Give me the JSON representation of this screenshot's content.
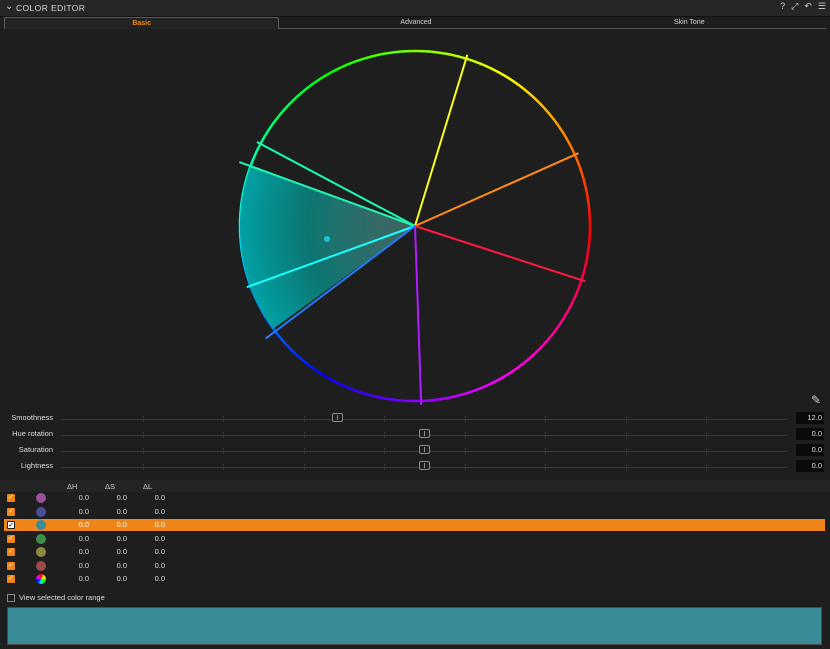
{
  "window": {
    "title": "COLOR EDITOR",
    "colors": {
      "accent": "#f08a1e",
      "preview": "#3a8c98"
    }
  },
  "toolbar_icons": [
    "help-icon",
    "expand-icon",
    "reset-icon",
    "menu-icon"
  ],
  "toolbar_glyphs": [
    "?",
    "⤢",
    "↶",
    "☰"
  ],
  "tabs": [
    {
      "label": "Basic",
      "active": true
    },
    {
      "label": "Advanced",
      "active": false
    },
    {
      "label": "Skin Tone",
      "active": false
    }
  ],
  "sliders": [
    {
      "label": "Smoothness",
      "value": "12.0",
      "level": 0.38
    },
    {
      "label": "Hue rotation",
      "value": "0.0",
      "level": 0.5
    },
    {
      "label": "Saturation",
      "value": "0.0",
      "level": 0.5
    },
    {
      "label": "Lightness",
      "value": "0.0",
      "level": 0.5
    }
  ],
  "table": {
    "headers": [
      "ΔH",
      "ΔS",
      "ΔL"
    ],
    "rows": [
      {
        "checked": true,
        "color": "#9a4f9a",
        "dh": "0.0",
        "ds": "0.0",
        "dl": "0.0",
        "selected": false
      },
      {
        "checked": true,
        "color": "#4a4f9c",
        "dh": "0.0",
        "ds": "0.0",
        "dl": "0.0",
        "selected": false
      },
      {
        "checked": true,
        "color": "#3a8c98",
        "dh": "0.0",
        "ds": "0.0",
        "dl": "0.0",
        "selected": true
      },
      {
        "checked": true,
        "color": "#3e8d4a",
        "dh": "0.0",
        "ds": "0.0",
        "dl": "0.0",
        "selected": false
      },
      {
        "checked": true,
        "color": "#8a8a42",
        "dh": "0.0",
        "ds": "0.0",
        "dl": "0.0",
        "selected": false
      },
      {
        "checked": true,
        "color": "#a04848",
        "dh": "0.0",
        "ds": "0.0",
        "dl": "0.0",
        "selected": false
      },
      {
        "checked": true,
        "color": "rainbow",
        "dh": "0.0",
        "ds": "0.0",
        "dl": "0.0",
        "selected": false
      }
    ]
  },
  "view_selected_label": "View selected color range",
  "view_selected_checked": false
}
